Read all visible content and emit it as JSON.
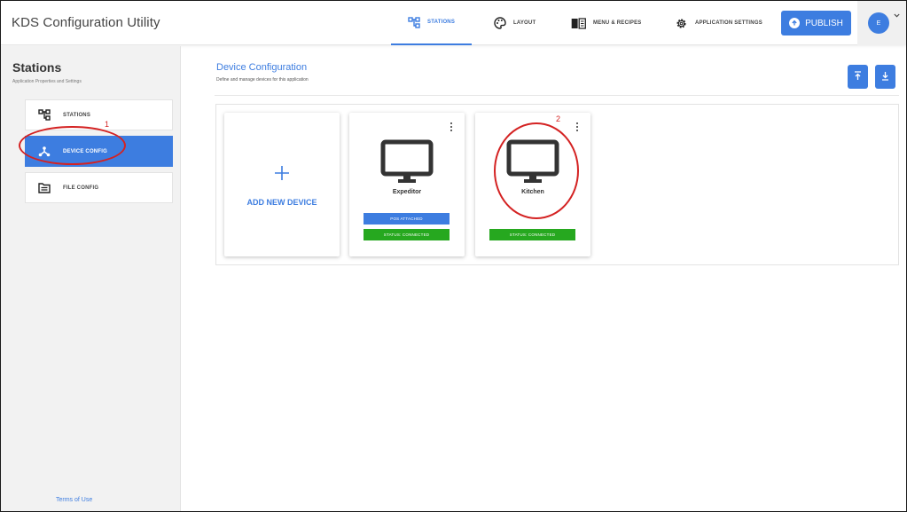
{
  "app_title": "KDS Configuration Utility",
  "nav": {
    "tabs": [
      {
        "label": "STATIONS",
        "icon": "stations-icon",
        "active": true
      },
      {
        "label": "LAYOUT",
        "icon": "palette-icon",
        "active": false
      },
      {
        "label": "MENU & RECIPES",
        "icon": "book-icon",
        "active": false
      },
      {
        "label": "APPLICATION SETTINGS",
        "icon": "gear-icon",
        "active": false
      }
    ],
    "publish_label": "PUBLISH",
    "avatar_initial": "E"
  },
  "sidebar": {
    "title": "Stations",
    "subtitle": "Application Properties and Settings",
    "items": [
      {
        "label": "STATIONS",
        "icon": "stations-icon",
        "active": false
      },
      {
        "label": "DEVICE CONFIG",
        "icon": "device-tree-icon",
        "active": true
      },
      {
        "label": "FILE CONFIG",
        "icon": "file-icon",
        "active": false
      }
    ],
    "terms_label": "Terms of Use"
  },
  "main": {
    "title": "Device Configuration",
    "subtitle": "Define and manage devices for this application",
    "add_device_label": "ADD NEW DEVICE",
    "devices": [
      {
        "name": "Expeditor",
        "badges": [
          {
            "text": "POS ATTACHED",
            "color": "#3d7de0"
          },
          {
            "text": "STATUS: CONNECTED",
            "color": "#26a81f"
          }
        ]
      },
      {
        "name": "Kitchen",
        "badges": [
          {
            "text": "STATUS: CONNECTED",
            "color": "#26a81f"
          }
        ]
      }
    ]
  },
  "annotations": [
    "1",
    "2"
  ],
  "colors": {
    "accent": "#3d7de0",
    "connected": "#26a81f",
    "annotation": "#d42222"
  }
}
